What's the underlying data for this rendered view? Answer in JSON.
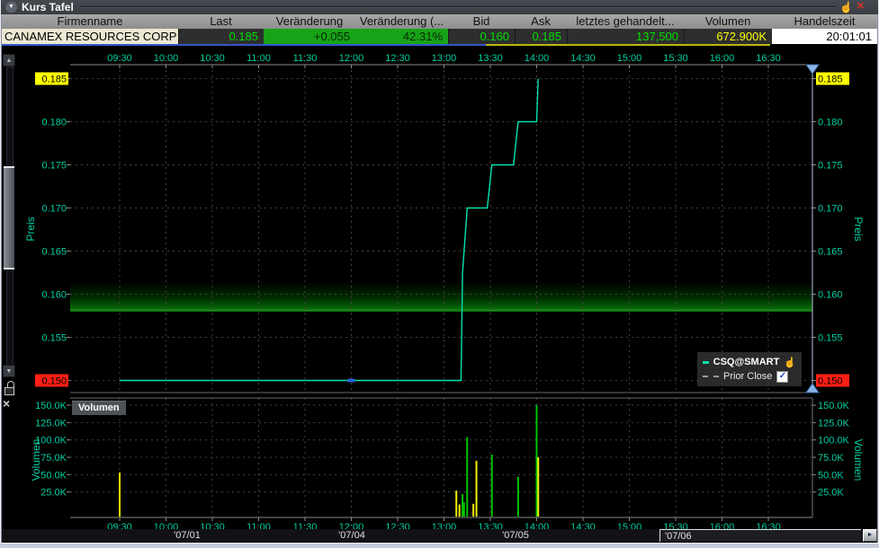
{
  "window": {
    "title": "Kurs Tafel"
  },
  "icons": {
    "collapse": "▼",
    "hand": "☝",
    "close": "×",
    "up": "▲",
    "down": "▼",
    "right": "►",
    "check": "✓"
  },
  "quote_table": {
    "headers": [
      "Firmenname",
      "Last",
      "Veränderung",
      "Veränderung (...",
      "Bid",
      "Ask",
      "letztes gehandelt...",
      "Volumen",
      "Handelszeit"
    ],
    "row": {
      "firmenname": "CANAMEX RESOURCES CORP",
      "last": "0.185",
      "change": "+0.055",
      "change_pct": "42.31%",
      "bid": "0.160",
      "ask": "0.185",
      "last_traded_size": "137,500",
      "volume": "672.900K",
      "trade_time": "20:01:01"
    }
  },
  "legend": {
    "items": [
      {
        "label": "CSQ@SMART",
        "swatch": "solid",
        "color": "#00e2ae"
      },
      {
        "label": "Prior Close",
        "swatch": "dashed",
        "color": "#9a9a9a",
        "checked": true
      }
    ]
  },
  "chart_data": {
    "type": "line",
    "title": "",
    "price_pane": {
      "ylabel_left": "Preis",
      "ylabel_right": "Preis",
      "ticks": [
        {
          "v": 0.185,
          "label": "0.185",
          "chip": "#ffff00"
        },
        {
          "v": 0.18,
          "label": "0.180"
        },
        {
          "v": 0.175,
          "label": "0.175"
        },
        {
          "v": 0.17,
          "label": "0.170"
        },
        {
          "v": 0.165,
          "label": "0.165"
        },
        {
          "v": 0.16,
          "label": "0.160"
        },
        {
          "v": 0.155,
          "label": "0.155"
        },
        {
          "v": 0.15,
          "label": "0.150",
          "chip": "#ff1f14"
        }
      ],
      "ylim": [
        0.1468,
        0.1868
      ]
    },
    "series": [
      {
        "name": "CSQ@SMART",
        "color": "#00e2ae",
        "points_min_price": [
          [
            0,
            0.15
          ],
          [
            221,
            0.15
          ],
          [
            222,
            0.1625
          ],
          [
            225,
            0.17
          ],
          [
            238,
            0.17
          ],
          [
            241,
            0.175
          ],
          [
            255,
            0.175
          ],
          [
            258,
            0.18
          ],
          [
            270,
            0.18
          ],
          [
            271,
            0.185
          ]
        ]
      }
    ],
    "marker": {
      "t": 150,
      "price": 0.15,
      "color": "#2a5fd6"
    },
    "prior_close_band": {
      "bottom_price": 0.158,
      "top_price": 0.1615
    },
    "x_ticks": [
      "09:30",
      "10:00",
      "10:30",
      "11:00",
      "11:30",
      "12:00",
      "12:30",
      "13:00",
      "13:30",
      "14:00",
      "14:30",
      "15:00",
      "15:30",
      "16:00",
      "16:30"
    ],
    "volume_pane": {
      "title": "Volumen",
      "ylabel_left": "Volumen",
      "ylabel_right": "Volumen",
      "ticks": [
        {
          "v": 150,
          "label": "150.0K"
        },
        {
          "v": 125,
          "label": "125.0K"
        },
        {
          "v": 100,
          "label": "100.0K"
        },
        {
          "v": 75,
          "label": "75.0K"
        },
        {
          "v": 50,
          "label": "50.0K"
        },
        {
          "v": 25,
          "label": "25.0K"
        }
      ],
      "bars": [
        {
          "t": 0,
          "v": 53,
          "c": "y"
        },
        {
          "t": 218,
          "v": 27,
          "c": "y"
        },
        {
          "t": 220,
          "v": 7,
          "c": "y"
        },
        {
          "t": 222,
          "v": 22,
          "c": "g"
        },
        {
          "t": 223,
          "v": 10,
          "c": "g"
        },
        {
          "t": 225,
          "v": 104,
          "c": "g"
        },
        {
          "t": 229,
          "v": 8,
          "c": "y"
        },
        {
          "t": 231,
          "v": 70,
          "c": "y"
        },
        {
          "t": 241,
          "v": 79,
          "c": "g"
        },
        {
          "t": 258,
          "v": 47,
          "c": "g"
        },
        {
          "t": 270,
          "v": 150,
          "c": "g"
        },
        {
          "t": 271,
          "v": 75,
          "c": "y"
        }
      ],
      "bar_colors": {
        "y": "#f0f000",
        "g": "#00c400"
      }
    },
    "date_scrollbar": {
      "labels": [
        {
          "text": "'07/01",
          "x": 206
        },
        {
          "text": "'07/04",
          "x": 389
        },
        {
          "text": "'07/05",
          "x": 571
        }
      ],
      "thumb_label": "'07/06"
    },
    "colors": {
      "axis_text": "#00cfa2",
      "grid": "#424242",
      "axis_line": "#8a8a8a"
    }
  }
}
